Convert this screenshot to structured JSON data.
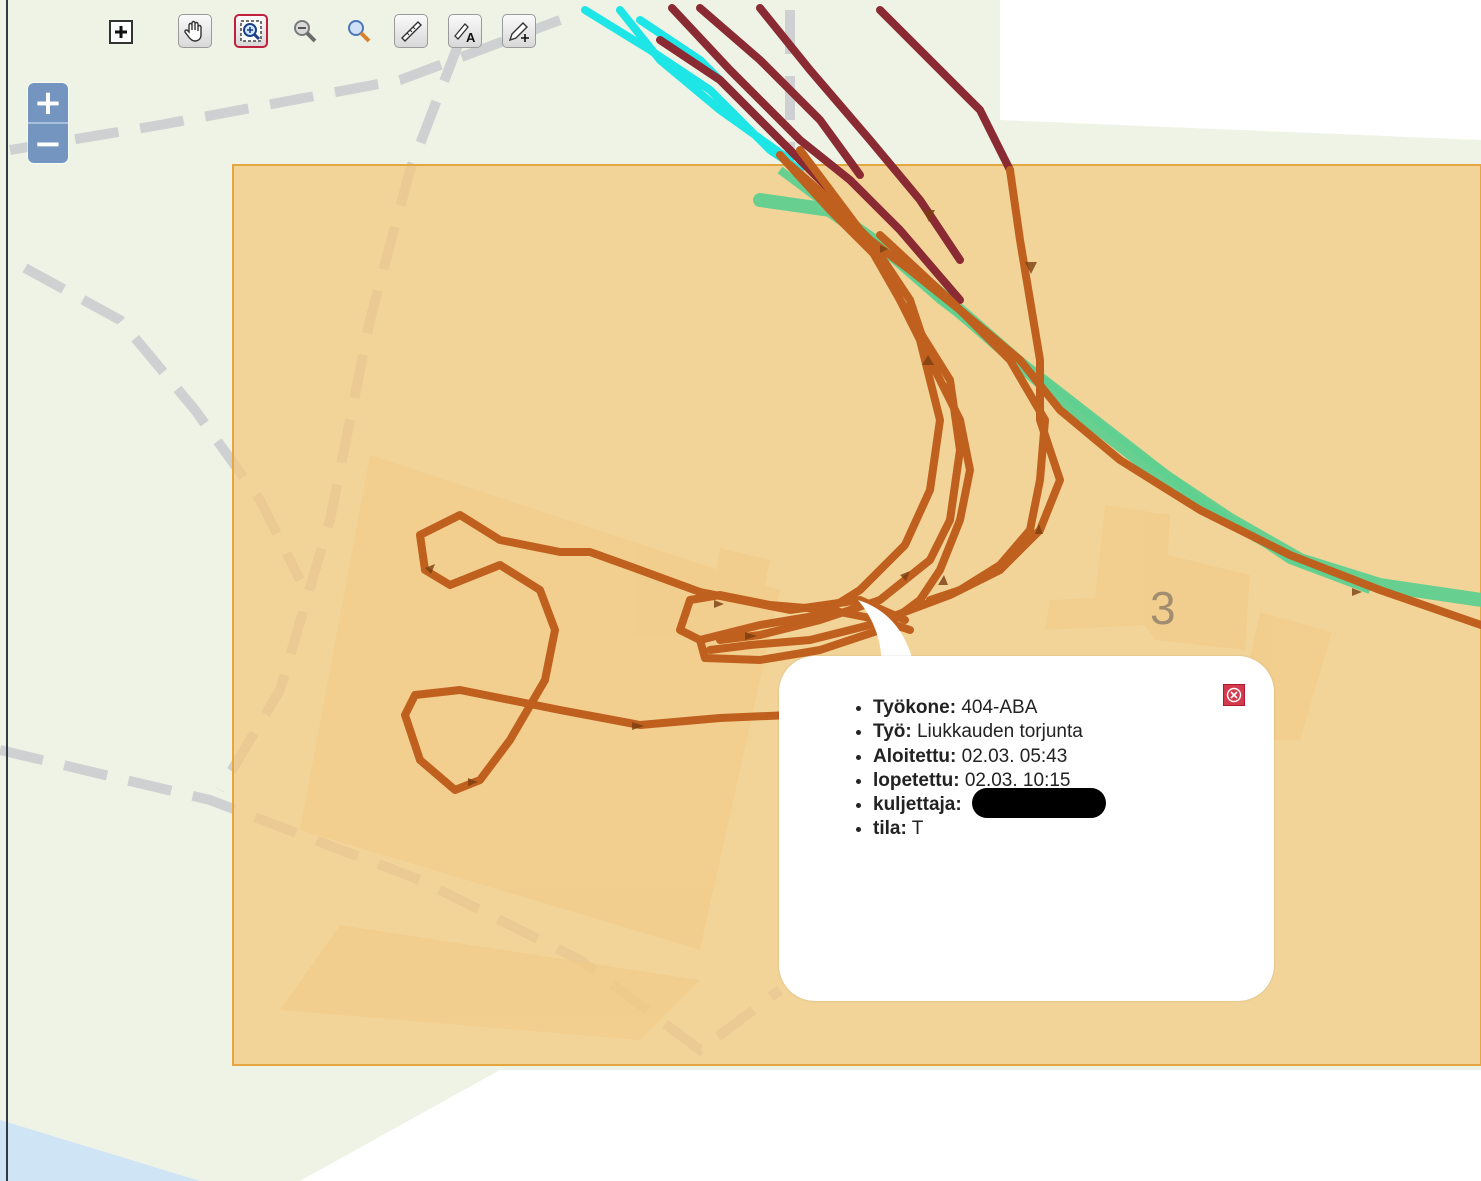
{
  "toolbar": {
    "tools": [
      {
        "name": "add-layer",
        "icon": "plus-square-icon"
      },
      {
        "name": "pan",
        "icon": "hand-icon"
      },
      {
        "name": "zoom-box",
        "icon": "zoom-box-icon",
        "active": true
      },
      {
        "name": "zoom-out",
        "icon": "magnifier-minus-icon"
      },
      {
        "name": "zoom-in",
        "icon": "magnifier-plus-icon"
      },
      {
        "name": "measure",
        "icon": "ruler-icon"
      },
      {
        "name": "annotate-text",
        "icon": "text-pen-icon"
      },
      {
        "name": "draw",
        "icon": "pencil-plus-icon"
      }
    ]
  },
  "zoom": {
    "in_label": "+",
    "out_label": "−"
  },
  "map": {
    "building_number": "3",
    "colors": {
      "selection_area": "#f5c87a",
      "track_orange": "#c0601f",
      "track_dark_red": "#8a2a32",
      "track_cyan": "#1ee6e6",
      "track_green": "#5fd08f",
      "land": "#eef3e6",
      "road_dashed": "#cfd0d2"
    }
  },
  "popup": {
    "items": [
      {
        "label": "Työkone:",
        "value": " 404-ABA"
      },
      {
        "label": "Työ:",
        "value": " Liukkauden torjunta"
      },
      {
        "label": "Aloitettu:",
        "value": " 02.03. 05:43"
      },
      {
        "label": "lopetettu:",
        "value": " 02.03. 10:15"
      },
      {
        "label": "kuljettaja:",
        "value": ""
      },
      {
        "label": "tila:",
        "value": " T"
      }
    ]
  }
}
